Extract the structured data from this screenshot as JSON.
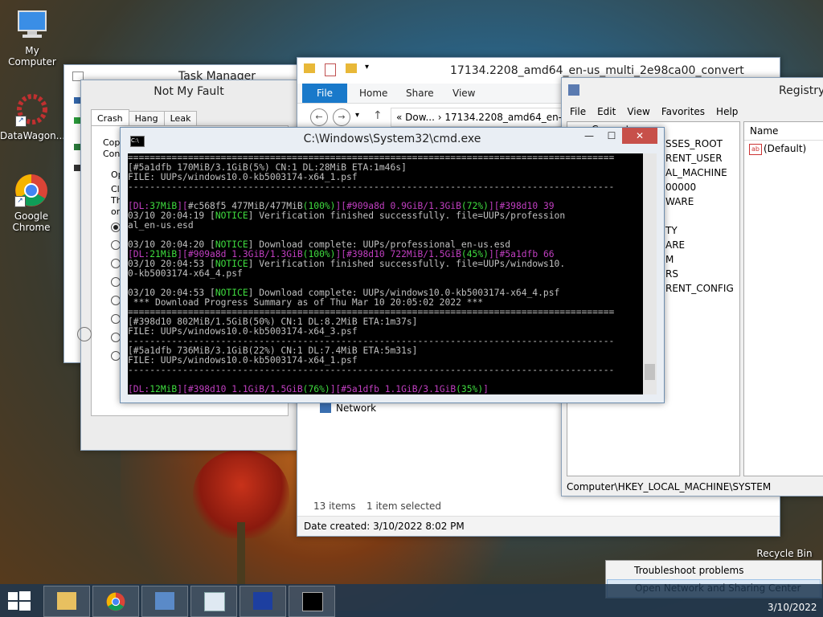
{
  "desktop": {
    "icons": [
      {
        "label": "My Computer"
      },
      {
        "label": "DataWagon..."
      },
      {
        "label": "Google Chrome"
      },
      {
        "label": "Recycle Bin"
      }
    ]
  },
  "task_manager": {
    "title": "Task Manager"
  },
  "not_my_fault": {
    "title": "Not My Fault",
    "tabs": [
      "Crash",
      "Hang",
      "Leak"
    ],
    "fragments": [
      "Copy",
      "Cont",
      "Op",
      "Cli",
      "Th",
      "or"
    ]
  },
  "explorer": {
    "title": "17134.2208_amd64_en-us_multi_2e98ca00_convert",
    "ribbon_tabs": [
      "File",
      "Home",
      "Share",
      "View"
    ],
    "address_crumbs": "« Dow...  ›  17134.2208_amd64_en-",
    "nav_network": "Network",
    "status_items": "13 items",
    "status_selected": "1 item selected",
    "details": "Date created: 3/10/2022 8:02 PM"
  },
  "registry": {
    "title": "Registry",
    "menu": [
      "File",
      "Edit",
      "View",
      "Favorites",
      "Help"
    ],
    "tree_root": "Computer",
    "tree_keys": [
      "SSES_ROOT",
      "RENT_USER",
      "AL_MACHINE",
      "00000",
      "WARE",
      "TY",
      "ARE",
      "M",
      "RS",
      "RENT_CONFIG"
    ],
    "values_header": "Name",
    "values_first": "(Default)",
    "status_path": "Computer\\HKEY_LOCAL_MACHINE\\SYSTEM"
  },
  "cmd": {
    "title": "C:\\Windows\\System32\\cmd.exe",
    "l01": "=========================================================================================",
    "l02": "[#5a1dfb 170MiB/3.1GiB(5%) CN:1 DL:28MiB ETA:1m46s]",
    "l03": "FILE: UUPs/windows10.0-kb5003174-x64_1.psf",
    "l04": "-----------------------------------------------------------------------------------------",
    "l05": "",
    "l06a": "[DL:",
    "l06b": "37MiB",
    "l06c": "][",
    "l06d": "#c568f5 477MiB/477MiB",
    "l06e": "(100%)",
    "l06f": "][#909a8d 0.9GiB/1.3GiB",
    "l06g": "(72%)",
    "l06h": "][#398d10 39",
    "l07a": "03/10 20:04:19 [",
    "l07b": "NOTICE",
    "l07c": "] Verification finished successfully. file=UUPs/profession",
    "l08": "al_en-us.esd",
    "l09": "",
    "l10a": "03/10 20:04:20 [",
    "l10b": "NOTICE",
    "l10c": "] Download complete: UUPs/professional_en-us.esd",
    "l11a": "[DL:",
    "l11b": "21MiB",
    "l11c": "][#909a8d 1.3GiB/1.3GiB",
    "l11d": "(100%)",
    "l11e": "][#398d10 722MiB/1.5GiB",
    "l11f": "(45%)",
    "l11g": "][#5a1dfb 66",
    "l12a": "03/10 20:04:53 [",
    "l12b": "NOTICE",
    "l12c": "] Verification finished successfully. file=UUPs/windows10.",
    "l13": "0-kb5003174-x64_4.psf",
    "l14": "",
    "l15a": "03/10 20:04:53 [",
    "l15b": "NOTICE",
    "l15c": "] Download complete: UUPs/windows10.0-kb5003174-x64_4.psf",
    "l16": " *** Download Progress Summary as of Thu Mar 10 20:05:02 2022 ***",
    "l17": "=========================================================================================",
    "l18": "[#398d10 802MiB/1.5GiB(50%) CN:1 DL:8.2MiB ETA:1m37s]",
    "l19": "FILE: UUPs/windows10.0-kb5003174-x64_3.psf",
    "l20": "-----------------------------------------------------------------------------------------",
    "l21": "[#5a1dfb 736MiB/3.1GiB(22%) CN:1 DL:7.4MiB ETA:5m31s]",
    "l22": "FILE: UUPs/windows10.0-kb5003174-x64_1.psf",
    "l23": "-----------------------------------------------------------------------------------------",
    "l24": "",
    "l25a": "[DL:",
    "l25b": "12MiB",
    "l25c": "][#398d10 1.1GiB/1.5GiB",
    "l25d": "(76%)",
    "l25e": "][#5a1dfb 1.1GiB/3.1GiB",
    "l25f": "(35%)",
    "l25g": "]"
  },
  "context_menu": {
    "items": [
      "Troubleshoot problems",
      "Open Network and Sharing Center"
    ]
  },
  "taskbar": {
    "date": "3/10/2022"
  },
  "colors": {
    "cmd_green": "#3fdc3f",
    "cmd_magenta": "#c13fc1",
    "cmd_yellow": "#ffff55",
    "explorer_file_tab": "#1979ca",
    "close_button": "#c7504a"
  }
}
